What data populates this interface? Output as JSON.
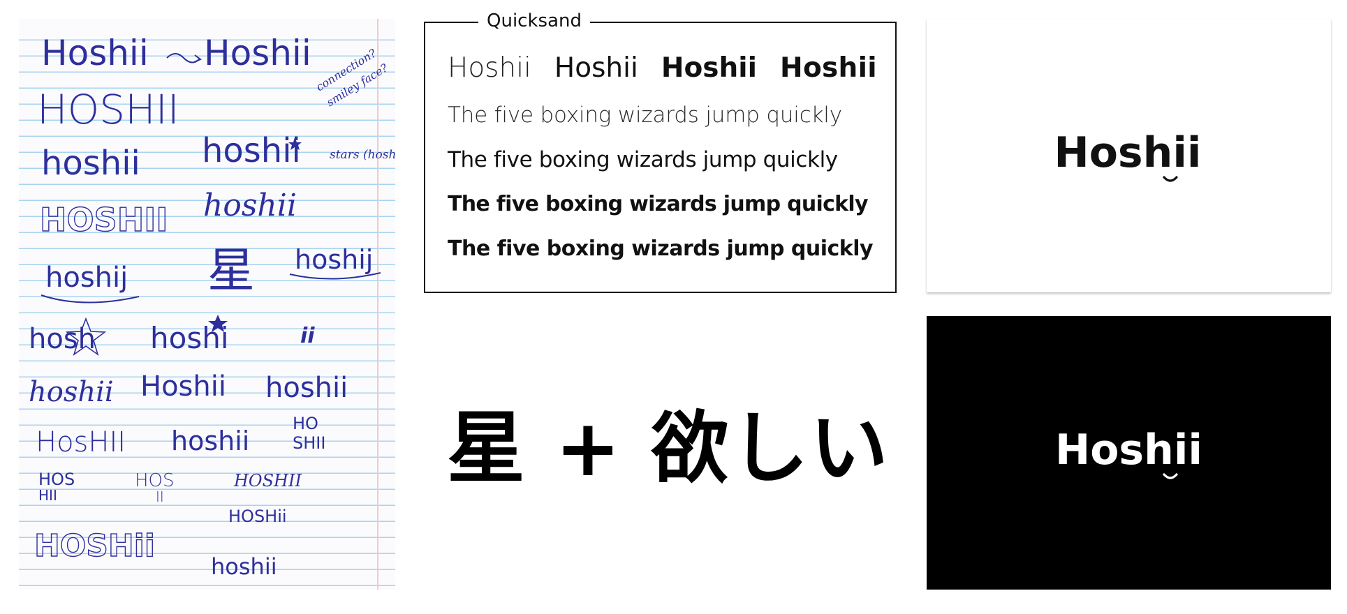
{
  "sketch": {
    "lines": {
      "row1_left": "Hoshii",
      "row1_right": "Hoshii",
      "note_a": "connection?",
      "note_b": "smiley face?",
      "row2": "HOSHII",
      "row3_left": "hoshii",
      "row3_right": "hoshii",
      "stars_note": "stars (hoshi)",
      "row4_outline": "HOSHII",
      "row4_script": "hoshii",
      "row5_left": "hoshij",
      "row5_kanji": "星",
      "row5_right": "hoshij",
      "row6_left": "hosh",
      "row6_mid": "hoshi",
      "row6_right": "ii",
      "row7_left": "hoshii",
      "row7_mid": "Hoshii",
      "row7_right": "hoshii",
      "row8_left": "HosHII",
      "row8_mid": "hoshii",
      "row8_right_top": "HO",
      "row8_right_bottom": "SHII",
      "row9_a_top": "HOS",
      "row9_a_bottom": "HII",
      "row9_b_top": "HOS",
      "row9_b_bottom": "II",
      "row9_c": "HOSHII",
      "row10_c": "HOSHii",
      "row11_outline": "HOSHii",
      "row11_right": "hoshii"
    }
  },
  "specimen": {
    "font_name": "Quicksand",
    "weights": [
      "Hoshii",
      "Hoshii",
      "Hoshii",
      "Hoshii"
    ],
    "pangrams": [
      "The five boxing wizards jump quickly",
      "The five boxing wizards jump quickly",
      "The five boxing wizards jump quickly",
      "The five boxing wizards jump quickly"
    ]
  },
  "equation": "星 + 欲しい",
  "logo_light": {
    "prefix": "Hosh",
    "suffix": "ii"
  },
  "logo_dark": {
    "prefix": "Hosh",
    "suffix": "ii"
  },
  "colors": {
    "ink": "#2e2f9c",
    "rule": "#a8d3ee",
    "margin": "#f3c7c7"
  },
  "icons": {
    "star": "star-icon",
    "smile": "smile-icon"
  }
}
